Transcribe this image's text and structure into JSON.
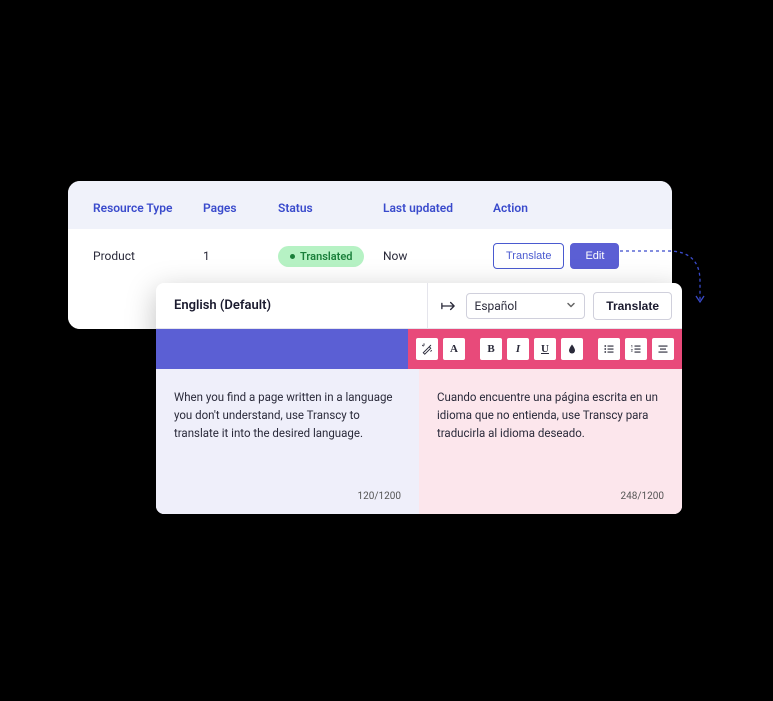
{
  "table": {
    "headers": {
      "resource_type": "Resource Type",
      "pages": "Pages",
      "status": "Status",
      "last_updated": "Last updated",
      "action": "Action"
    },
    "row": {
      "resource_type": "Product",
      "pages": "1",
      "status": "Translated",
      "last_updated": "Now",
      "translate_label": "Translate",
      "edit_label": "Edit"
    }
  },
  "editor": {
    "source_lang_label": "English (Default)",
    "target_lang_selected": "Español",
    "translate_label": "Translate",
    "source_text": "When you find a page written in a language you don't understand, use Transcy to translate it into the desired language.",
    "source_count": "120/1200",
    "target_text": "Cuando encuentre una página escrita en un idioma que no entienda, use Transcy para traducirla al idioma deseado.",
    "target_count": "248/1200"
  }
}
